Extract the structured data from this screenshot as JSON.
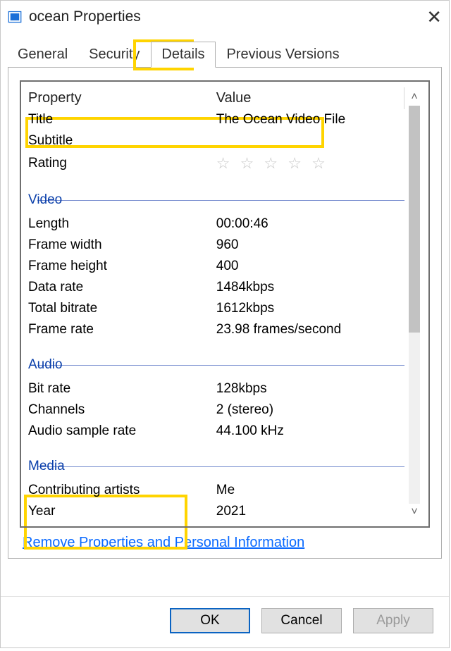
{
  "window": {
    "title": "ocean Properties"
  },
  "tabs": [
    "General",
    "Security",
    "Details",
    "Previous Versions"
  ],
  "active_tab": "Details",
  "columns": {
    "property": "Property",
    "value": "Value"
  },
  "rows": {
    "title": {
      "p": "Title",
      "v": "The Ocean Video File"
    },
    "subtitle": {
      "p": "Subtitle",
      "v": ""
    },
    "rating": {
      "p": "Rating",
      "v": "☆ ☆ ☆ ☆ ☆"
    }
  },
  "sections": {
    "video": "Video",
    "audio": "Audio",
    "media": "Media"
  },
  "video": {
    "length": {
      "p": "Length",
      "v": "00:00:46"
    },
    "frame_width": {
      "p": "Frame width",
      "v": "960"
    },
    "frame_height": {
      "p": "Frame height",
      "v": "400"
    },
    "data_rate": {
      "p": "Data rate",
      "v": "1484kbps"
    },
    "total_bitrate": {
      "p": "Total bitrate",
      "v": "1612kbps"
    },
    "frame_rate": {
      "p": "Frame rate",
      "v": "23.98 frames/second"
    }
  },
  "audio": {
    "bit_rate": {
      "p": "Bit rate",
      "v": "128kbps"
    },
    "channels": {
      "p": "Channels",
      "v": "2 (stereo)"
    },
    "sample_rate": {
      "p": "Audio sample rate",
      "v": "44.100 kHz"
    }
  },
  "media": {
    "artists": {
      "p": "Contributing artists",
      "v": "Me"
    },
    "year": {
      "p": "Year",
      "v": "2021"
    }
  },
  "link": "Remove Properties and Personal Information",
  "buttons": {
    "ok": "OK",
    "cancel": "Cancel",
    "apply": "Apply"
  }
}
